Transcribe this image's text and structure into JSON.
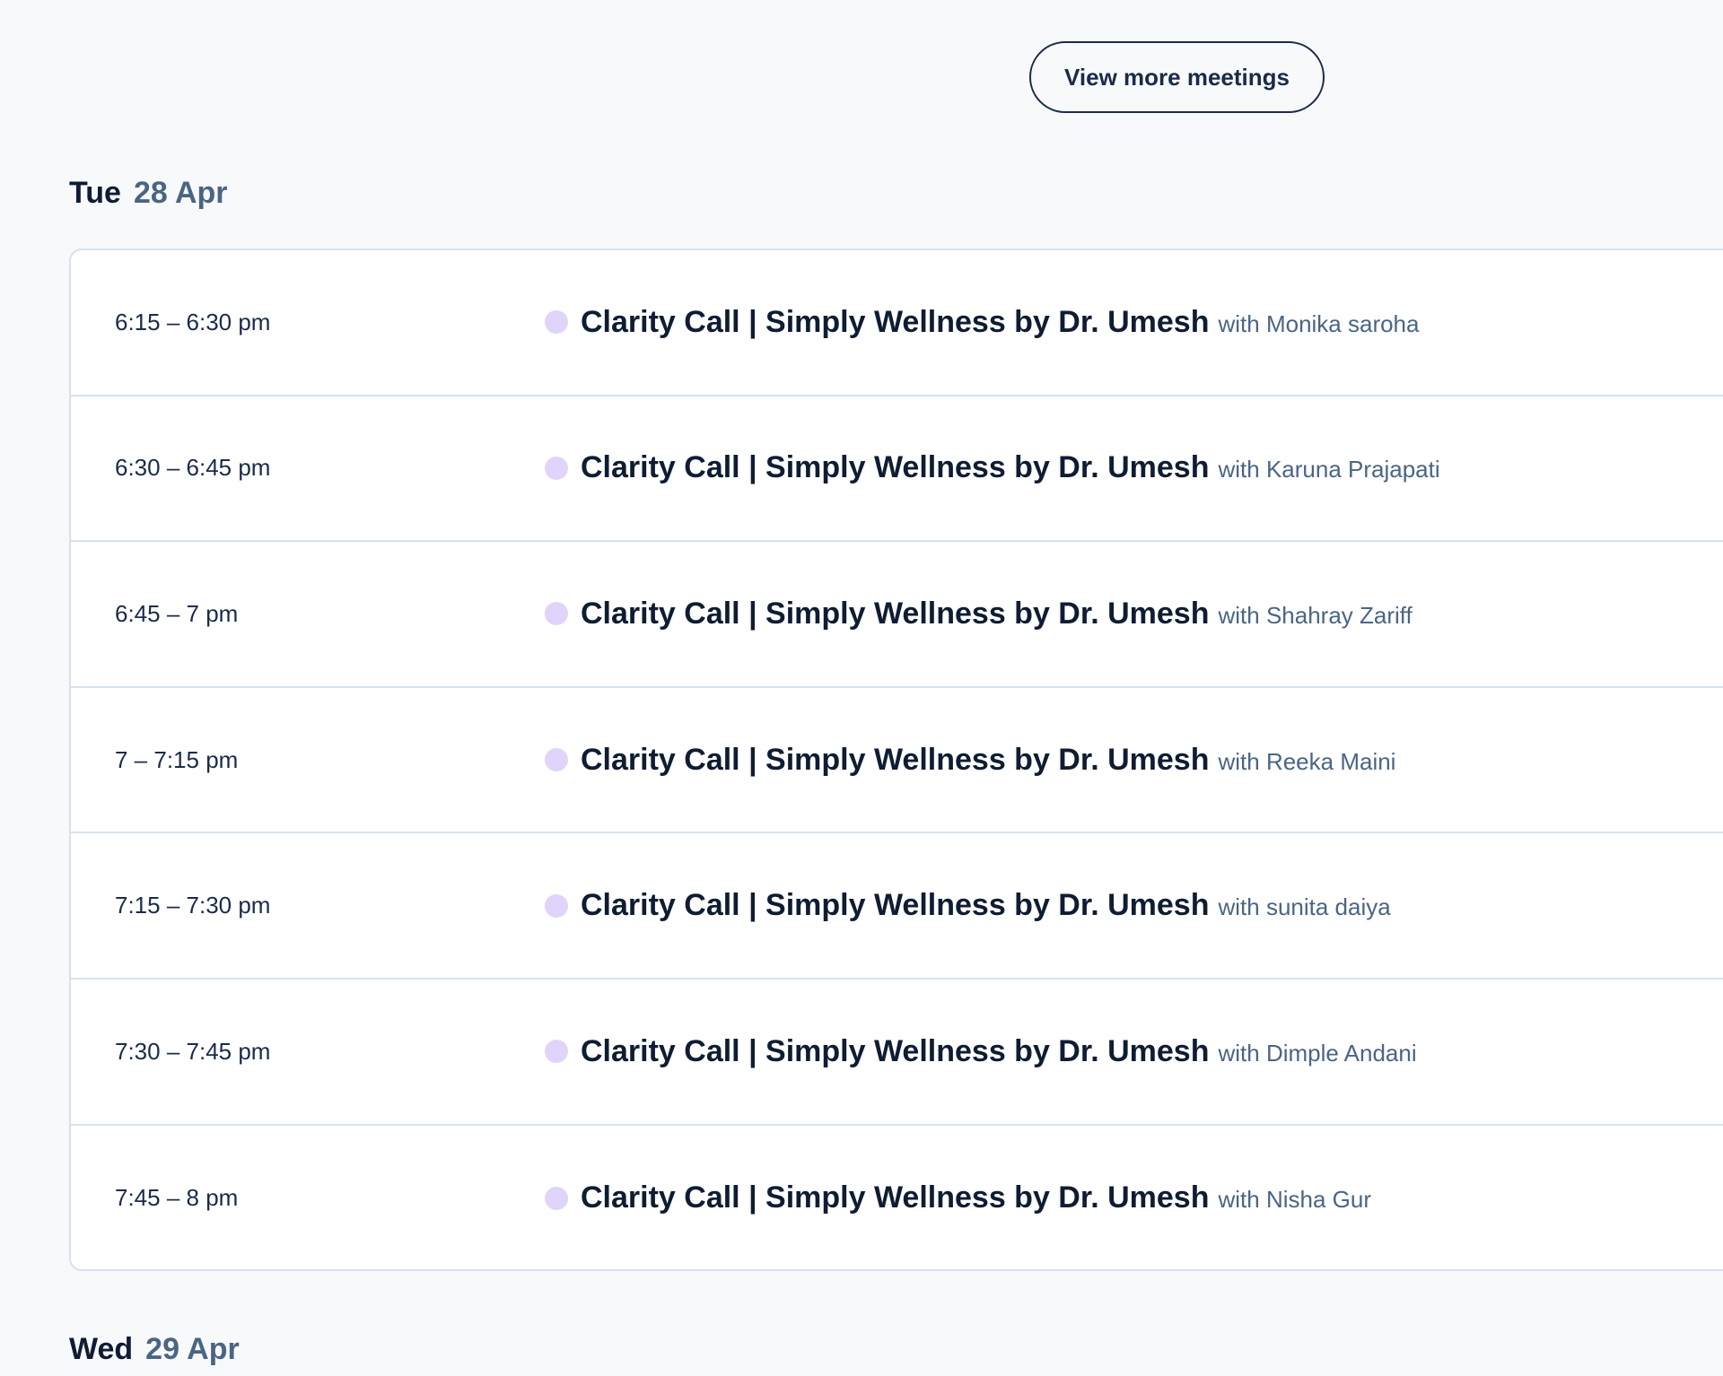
{
  "view_more_label": "View more meetings",
  "colors": {
    "event_dot": "#e0d4fb",
    "text_dark": "#0f1d33",
    "text_muted": "#4a6584"
  },
  "days": [
    {
      "weekday": "Tue",
      "date": "28 Apr",
      "meetings": [
        {
          "time": "6:15 – 6:30 pm",
          "title": "Clarity Call | Simply Wellness by Dr. Umesh",
          "with": "with Monika saroha"
        },
        {
          "time": "6:30 – 6:45 pm",
          "title": "Clarity Call | Simply Wellness by Dr. Umesh",
          "with": "with Karuna Prajapati"
        },
        {
          "time": "6:45 – 7 pm",
          "title": "Clarity Call | Simply Wellness by Dr. Umesh",
          "with": "with Shahray Zariff"
        },
        {
          "time": "7 – 7:15 pm",
          "title": "Clarity Call | Simply Wellness by Dr. Umesh",
          "with": "with Reeka Maini"
        },
        {
          "time": "7:15 – 7:30 pm",
          "title": "Clarity Call | Simply Wellness by Dr. Umesh",
          "with": "with sunita daiya"
        },
        {
          "time": "7:30 – 7:45 pm",
          "title": "Clarity Call | Simply Wellness by Dr. Umesh",
          "with": "with Dimple Andani"
        },
        {
          "time": "7:45 – 8 pm",
          "title": "Clarity Call | Simply Wellness by Dr. Umesh",
          "with": "with Nisha Gur"
        }
      ]
    },
    {
      "weekday": "Wed",
      "date": "29 Apr",
      "meetings": []
    }
  ]
}
